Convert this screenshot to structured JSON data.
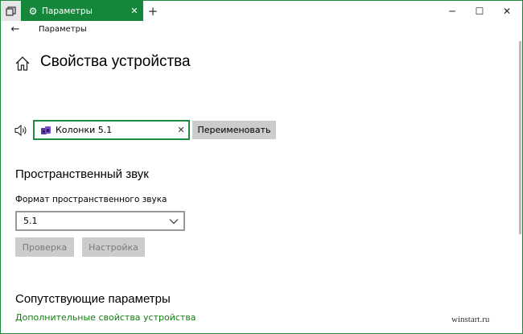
{
  "window": {
    "tab_title": "Параметры",
    "tab_gear_glyph": "⚙",
    "tab_close_glyph": "✕",
    "new_tab_glyph": "+",
    "minimize_glyph": "─",
    "maximize_glyph": "☐",
    "close_glyph": "✕",
    "accent_color": "#15873a"
  },
  "nav": {
    "back_glyph": "←",
    "title": "Параметры"
  },
  "page": {
    "title": "Свойства устройства"
  },
  "device": {
    "name_value": "Колонки 5.1",
    "clear_glyph": "✕",
    "rename_label": "Переименовать"
  },
  "spatial": {
    "section_title": "Пространственный звук",
    "format_label": "Формат пространственного звука",
    "format_value": "5.1",
    "check_label": "Проверка",
    "setup_label": "Настройка"
  },
  "related": {
    "section_title": "Сопутствующие параметры",
    "link_label": "Дополнительные свойства устройства"
  },
  "watermark": "winstart.ru",
  "icons": [
    "tab-switcher-icon",
    "gear-icon",
    "close-icon",
    "plus-icon",
    "minimize-icon",
    "maximize-icon",
    "back-arrow-icon",
    "home-icon",
    "speaker-icon",
    "device-icon",
    "chevron-down-icon"
  ]
}
